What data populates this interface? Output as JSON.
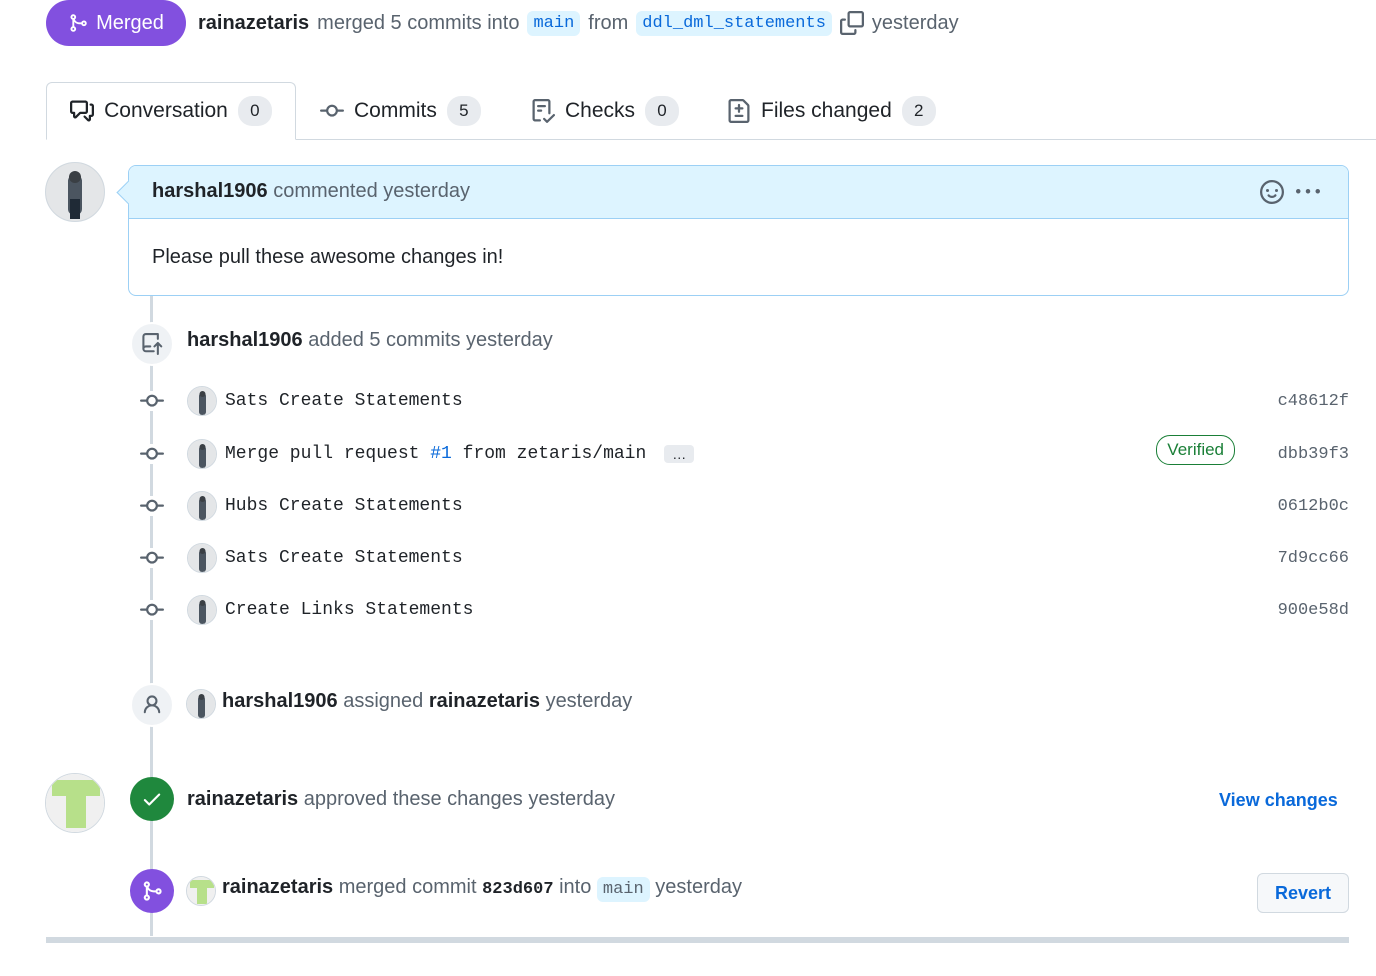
{
  "header": {
    "status_badge": "Merged",
    "author": "rainazetaris",
    "action": "merged 5 commits into",
    "base_branch": "main",
    "from_word": "from",
    "head_branch": "ddl_dml_statements",
    "time": "yesterday"
  },
  "tabs": [
    {
      "label": "Conversation",
      "count": "0"
    },
    {
      "label": "Commits",
      "count": "5"
    },
    {
      "label": "Checks",
      "count": "0"
    },
    {
      "label": "Files changed",
      "count": "2"
    }
  ],
  "comment": {
    "author": "harshal1906",
    "meta": "commented yesterday",
    "body": "Please pull these awesome changes in!"
  },
  "commits_event": {
    "author": "harshal1906",
    "text": "added 5 commits yesterday"
  },
  "commits": [
    {
      "message": "Sats Create Statements",
      "sha": "c48612f"
    },
    {
      "message_prefix": "Merge pull request ",
      "pr_link": "#1",
      "message_suffix": " from zetaris/main",
      "expander": "…",
      "badge": "Verified",
      "sha": "dbb39f3"
    },
    {
      "message": "Hubs Create Statements",
      "sha": "0612b0c"
    },
    {
      "message": "Sats Create Statements",
      "sha": "7d9cc66"
    },
    {
      "message": "Create Links Statements",
      "sha": "900e58d"
    }
  ],
  "assign_event": {
    "actor": "harshal1906",
    "verb": "assigned",
    "assignee": "rainazetaris",
    "time": "yesterday"
  },
  "approve_event": {
    "actor": "rainazetaris",
    "text": "approved these changes yesterday",
    "link": "View changes"
  },
  "merge_event": {
    "actor": "rainazetaris",
    "text_1": "merged commit",
    "sha": "823d607",
    "text_2": "into",
    "branch": "main",
    "time": "yesterday",
    "button": "Revert"
  },
  "colors": {
    "merged_purple": "#8250df",
    "approved_green": "#1f883d",
    "link_blue": "#0969da",
    "comment_header_bg": "#ddf4ff"
  }
}
